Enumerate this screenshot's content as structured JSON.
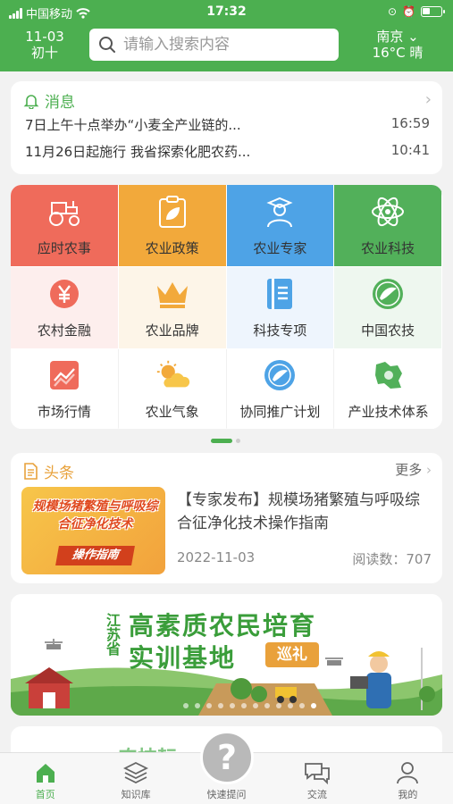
{
  "status_bar": {
    "carrier": "中国移动",
    "time": "17:32"
  },
  "header": {
    "date": "11-03",
    "lunar_date": "初十",
    "search_placeholder": "请输入搜索内容",
    "city": "南京",
    "weather": "16°C 晴",
    "color": "#4caf50"
  },
  "news": {
    "title": "消息",
    "items": [
      {
        "text": "7日上午十点举办“小麦全产业链的...",
        "time": "16:59"
      },
      {
        "text": "11月26日起施行 我省探索化肥农药...",
        "time": "10:41"
      }
    ]
  },
  "grid": {
    "items": [
      {
        "label": "应时农事",
        "icon": "tractor-icon"
      },
      {
        "label": "农业政策",
        "icon": "leaf-document-icon"
      },
      {
        "label": "农业专家",
        "icon": "expert-icon"
      },
      {
        "label": "农业科技",
        "icon": "atom-icon"
      },
      {
        "label": "农村金融",
        "icon": "yuan-icon"
      },
      {
        "label": "农业品牌",
        "icon": "crown-icon"
      },
      {
        "label": "科技专项",
        "icon": "book-icon"
      },
      {
        "label": "中国农技",
        "icon": "china-agritech-logo-icon"
      },
      {
        "label": "市场行情",
        "icon": "trend-chart-icon"
      },
      {
        "label": "农业气象",
        "icon": "sun-cloud-icon"
      },
      {
        "label": "协同推广计划",
        "icon": "promotion-badge-icon"
      },
      {
        "label": "产业技术体系",
        "icon": "jiangsu-map-icon"
      }
    ]
  },
  "headlines": {
    "title": "头条",
    "more": "更多",
    "thumb_text": "规模场猪繁殖与呼吸综合征净化技术",
    "thumb_tag": "操作指南",
    "article_title": "【专家发布】规模场猪繁殖与呼吸综合征净化技术操作指南",
    "date": "2022-11-03",
    "reads": "阅读数：707"
  },
  "banner": {
    "province": "江苏省",
    "line1": "高素质农民培育",
    "line2": "实训基地",
    "tag": "巡礼"
  },
  "peek": {
    "text": "农技耘"
  },
  "tabbar": {
    "items": [
      {
        "label": "首页",
        "icon": "home-icon",
        "active": true
      },
      {
        "label": "知识库",
        "icon": "layers-icon",
        "active": false
      },
      {
        "label": "快速提问",
        "icon": "question-icon",
        "active": false
      },
      {
        "label": "交流",
        "icon": "chat-icon",
        "active": false
      },
      {
        "label": "我的",
        "icon": "user-icon",
        "active": false
      }
    ],
    "fab_symbol": "?"
  }
}
